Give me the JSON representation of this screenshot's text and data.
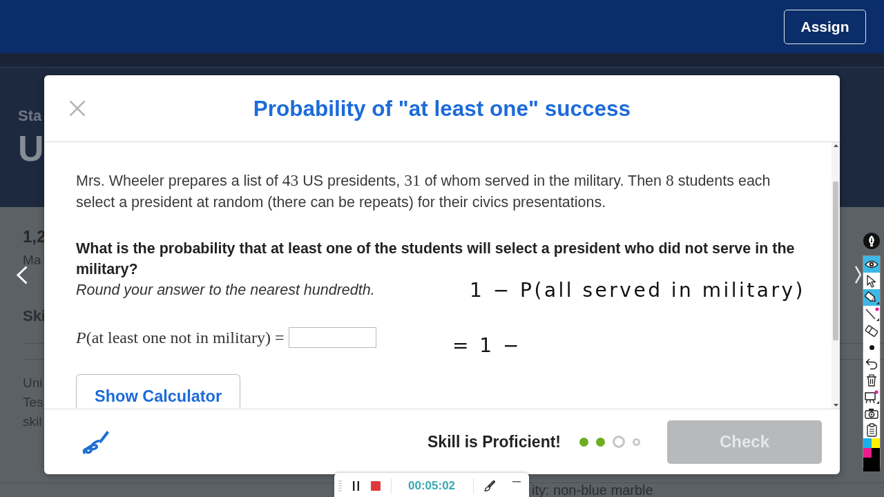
{
  "top_bar": {
    "assign_button": "Assign"
  },
  "background_page": {
    "title_fragments": [
      "Sta",
      "U"
    ],
    "stat_fragments": [
      "1,2",
      "Ma"
    ],
    "section_fragment": "Ski",
    "item_fragments": [
      "Uni",
      "Tes",
      "skil"
    ],
    "bottom_fragment": "ity: non-blue marble"
  },
  "dialog": {
    "title": "Probability of \"at least one\" success",
    "problem": [
      {
        "kind": "text",
        "text": "Mrs. Wheeler prepares a list of "
      },
      {
        "kind": "math",
        "text": "43"
      },
      {
        "kind": "text",
        "text": " US presidents, "
      },
      {
        "kind": "math",
        "text": "31"
      },
      {
        "kind": "text",
        "text": " of whom served in the military. Then "
      },
      {
        "kind": "math",
        "text": "8"
      },
      {
        "kind": "text",
        "text": " students each select a president at random (there can be repeats) for their civics presentations."
      }
    ],
    "question": "What is the probability that at least one of the students will select a president who did not serve in the military?",
    "instruction": "Round your answer to the nearest hundredth.",
    "equation": "*P*(at least one not in military) =",
    "calculator_button": "Show Calculator",
    "ink_notes": [
      "1 − P(all served in military)",
      "= 1 −"
    ]
  },
  "footer": {
    "status": "Skill is Proficient!",
    "progress": [
      {
        "filled": true,
        "current": false
      },
      {
        "filled": true,
        "current": false
      },
      {
        "filled": false,
        "current": true
      },
      {
        "filled": false,
        "current": false
      }
    ],
    "check_button": {
      "label": "Check",
      "disabled": true
    }
  },
  "annotation_toolbar": {
    "tools": [
      {
        "selected": true
      },
      {
        "selected": false
      },
      {
        "selected": true
      },
      {
        "selected": false
      },
      {
        "selected": false
      },
      {
        "selected": false
      },
      {
        "selected": false
      },
      {
        "selected": false
      },
      {
        "selected": false
      },
      {
        "selected": false
      },
      {
        "selected": false
      }
    ],
    "palette": [
      {
        "color": "#1eaee6"
      },
      {
        "color": "#fff200"
      },
      {
        "color": "#ec1c8c"
      },
      {
        "color": "#000000"
      },
      {
        "color": "#000000"
      }
    ]
  },
  "recorder": {
    "time": "00:05:02"
  }
}
